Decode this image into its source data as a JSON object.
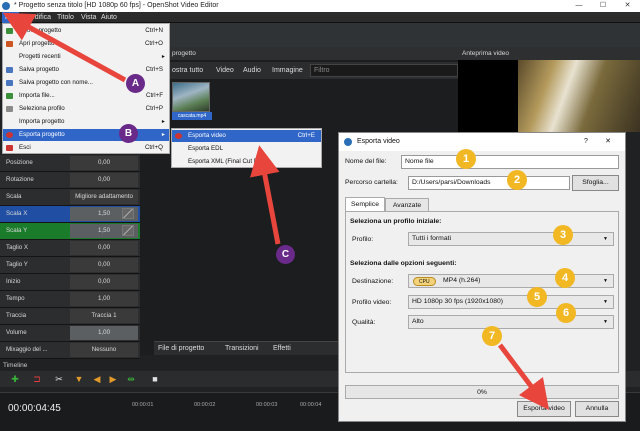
{
  "window": {
    "title": "* Progetto senza titolo [HD 1080p 60 fps] - OpenShot Video Editor",
    "minimize": "—",
    "maximize": "☐",
    "close": "✕"
  },
  "menubar": [
    "File",
    "Modifica",
    "Titolo",
    "Vista",
    "Aiuto"
  ],
  "file_menu": [
    {
      "label": "Nuovo progetto",
      "shortcut": "Ctrl+N",
      "icon_color": "#3b8f3b"
    },
    {
      "label": "Apri progetto",
      "shortcut": "Ctrl+O",
      "icon_color": "#cc5522"
    },
    {
      "label": "Progetti recenti",
      "shortcut": "",
      "submenu": true
    },
    {
      "label": "Salva progetto",
      "shortcut": "Ctrl+S",
      "icon_color": "#4a76c0"
    },
    {
      "label": "Salva progetto con nome...",
      "shortcut": "",
      "icon_color": "#4a76c0"
    },
    {
      "label": "Importa file...",
      "shortcut": "Ctrl+F",
      "icon_color": "#3b8f3b"
    },
    {
      "label": "Seleziona profilo",
      "shortcut": "Ctrl+P",
      "icon_color": "#8a8a8a"
    },
    {
      "label": "Importa progetto",
      "shortcut": "",
      "submenu": true
    },
    {
      "label": "Esporta progetto",
      "shortcut": "",
      "submenu": true,
      "highlighted": true,
      "icon_color": "#cc3333"
    },
    {
      "label": "Esci",
      "shortcut": "Ctrl+Q",
      "icon_color": "#cc3333"
    }
  ],
  "export_submenu": [
    {
      "label": "Esporta video",
      "shortcut": "Ctrl+E",
      "highlighted": true,
      "icon_color": "#cc3333"
    },
    {
      "label": "Esporta EDL",
      "shortcut": ""
    },
    {
      "label": "Esporta XML (Final Cut Pro)",
      "shortcut": ""
    }
  ],
  "properties": [
    {
      "name": "Posizione",
      "value": "0,00"
    },
    {
      "name": "Rotazione",
      "value": "0,00"
    },
    {
      "name": "Scala",
      "value": "Migliore adattamento"
    },
    {
      "name": "Scala X",
      "value": "1,50",
      "style": "blue"
    },
    {
      "name": "Scala Y",
      "value": "1,50",
      "style": "green"
    },
    {
      "name": "Taglio X",
      "value": "0,00"
    },
    {
      "name": "Taglio Y",
      "value": "0,00"
    },
    {
      "name": "Inizio",
      "value": "0,00"
    },
    {
      "name": "Tempo",
      "value": "1,00"
    },
    {
      "name": "Traccia",
      "value": "Traccia 1"
    },
    {
      "name": "Volume",
      "value": "1,00",
      "style": "bar"
    },
    {
      "name": "Mixaggio del ...",
      "value": "Nessuno"
    }
  ],
  "project_panel": {
    "title": "progetto",
    "tabs": [
      "ostra tutto",
      "Video",
      "Audio",
      "Immagine"
    ],
    "filter_placeholder": "Filtro",
    "thumbnail_label": "cascata.mp4"
  },
  "bottom_tabs": [
    "File di progetto",
    "Transizioni",
    "Effetti"
  ],
  "preview": {
    "title": "Anteprima video"
  },
  "timeline": {
    "label": "Timeline",
    "timecode": "00:00:04:45",
    "ruler_ticks": [
      "00:00:01",
      "00:00:02",
      "00:00:03",
      "00:00:04",
      "00:00:05",
      "00:00:06",
      "00:00:07"
    ]
  },
  "dialog": {
    "title": "Esporta video",
    "help": "?",
    "close": "✕",
    "filename_label": "Nome del file:",
    "filename_value": "Nome file",
    "folder_label": "Percorso cartella:",
    "folder_value": "D:/Users/parsi/Downloads",
    "browse_button": "Sfoglia...",
    "tabs": [
      "Semplice",
      "Avanzate"
    ],
    "section1": "Seleziona un profilo iniziale:",
    "profile_label": "Profilo:",
    "profile_value": "Tutti i formati",
    "section2": "Seleziona dalle opzioni seguenti:",
    "destination_label": "Destinazione:",
    "destination_badge": "CPU",
    "destination_value": "MP4 (h.264)",
    "video_profile_label": "Profilo video:",
    "video_profile_value": "HD 1080p 30 fps (1920x1080)",
    "quality_label": "Qualità:",
    "quality_value": "Alto",
    "progress": "0%",
    "export_button": "Esporta video",
    "cancel_button": "Annulla"
  },
  "annotations": {
    "letters": [
      "A",
      "B",
      "C"
    ],
    "numbers": [
      "1",
      "2",
      "3",
      "4",
      "5",
      "6",
      "7"
    ],
    "purple": "#6a2a8a",
    "yellow": "#f2b824",
    "arrow_red": "#e8453c"
  },
  "colors": {
    "accent": "#2f66c8",
    "scale_x": "#1f4ea3",
    "scale_y": "#1a7c2a"
  }
}
